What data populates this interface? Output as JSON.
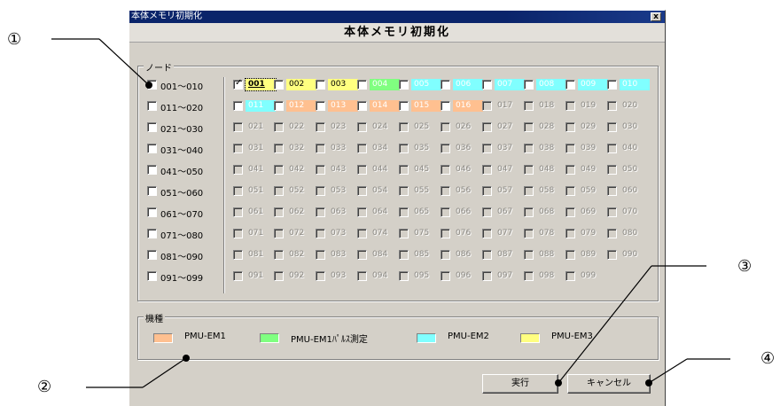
{
  "window": {
    "title": "本体メモリ初期化",
    "close": "x"
  },
  "header": {
    "title": "本体メモリ初期化"
  },
  "node_group": {
    "label": "ノード",
    "rows": [
      {
        "range": "001～010",
        "cells": [
          {
            "label": "001",
            "kind": "yellow",
            "checked": true
          },
          {
            "label": "002",
            "kind": "yellow"
          },
          {
            "label": "003",
            "kind": "yellow"
          },
          {
            "label": "004",
            "kind": "green"
          },
          {
            "label": "005",
            "kind": "cyan"
          },
          {
            "label": "006",
            "kind": "cyan"
          },
          {
            "label": "007",
            "kind": "cyan"
          },
          {
            "label": "008",
            "kind": "cyan"
          },
          {
            "label": "009",
            "kind": "cyan"
          },
          {
            "label": "010",
            "kind": "cyan"
          }
        ]
      },
      {
        "range": "011～020",
        "cells": [
          {
            "label": "011",
            "kind": "cyan"
          },
          {
            "label": "012",
            "kind": "orange"
          },
          {
            "label": "013",
            "kind": "orange"
          },
          {
            "label": "014",
            "kind": "orange"
          },
          {
            "label": "015",
            "kind": "orange"
          },
          {
            "label": "016",
            "kind": "orange"
          },
          {
            "label": "017",
            "kind": "disabled"
          },
          {
            "label": "018",
            "kind": "disabled"
          },
          {
            "label": "019",
            "kind": "disabled"
          },
          {
            "label": "020",
            "kind": "disabled"
          }
        ]
      },
      {
        "range": "021～030",
        "cells": [
          {
            "label": "021"
          },
          {
            "label": "022"
          },
          {
            "label": "023"
          },
          {
            "label": "024"
          },
          {
            "label": "025"
          },
          {
            "label": "026"
          },
          {
            "label": "027"
          },
          {
            "label": "028"
          },
          {
            "label": "029"
          },
          {
            "label": "030"
          }
        ]
      },
      {
        "range": "031～040",
        "cells": [
          {
            "label": "031"
          },
          {
            "label": "032"
          },
          {
            "label": "033"
          },
          {
            "label": "034"
          },
          {
            "label": "035"
          },
          {
            "label": "036"
          },
          {
            "label": "037"
          },
          {
            "label": "038"
          },
          {
            "label": "039"
          },
          {
            "label": "040"
          }
        ]
      },
      {
        "range": "041～050",
        "cells": [
          {
            "label": "041"
          },
          {
            "label": "042"
          },
          {
            "label": "043"
          },
          {
            "label": "044"
          },
          {
            "label": "045"
          },
          {
            "label": "046"
          },
          {
            "label": "047"
          },
          {
            "label": "048"
          },
          {
            "label": "049"
          },
          {
            "label": "050"
          }
        ]
      },
      {
        "range": "051～060",
        "cells": [
          {
            "label": "051"
          },
          {
            "label": "052"
          },
          {
            "label": "053"
          },
          {
            "label": "054"
          },
          {
            "label": "055"
          },
          {
            "label": "056"
          },
          {
            "label": "057"
          },
          {
            "label": "058"
          },
          {
            "label": "059"
          },
          {
            "label": "060"
          }
        ]
      },
      {
        "range": "061～070",
        "cells": [
          {
            "label": "061"
          },
          {
            "label": "062"
          },
          {
            "label": "063"
          },
          {
            "label": "064"
          },
          {
            "label": "065"
          },
          {
            "label": "066"
          },
          {
            "label": "067"
          },
          {
            "label": "068"
          },
          {
            "label": "069"
          },
          {
            "label": "070"
          }
        ]
      },
      {
        "range": "071～080",
        "cells": [
          {
            "label": "071"
          },
          {
            "label": "072"
          },
          {
            "label": "073"
          },
          {
            "label": "074"
          },
          {
            "label": "075"
          },
          {
            "label": "076"
          },
          {
            "label": "077"
          },
          {
            "label": "078"
          },
          {
            "label": "079"
          },
          {
            "label": "080"
          }
        ]
      },
      {
        "range": "081～090",
        "cells": [
          {
            "label": "081"
          },
          {
            "label": "082"
          },
          {
            "label": "083"
          },
          {
            "label": "084"
          },
          {
            "label": "085"
          },
          {
            "label": "086"
          },
          {
            "label": "087"
          },
          {
            "label": "088"
          },
          {
            "label": "089"
          },
          {
            "label": "090"
          }
        ]
      },
      {
        "range": "091～099",
        "cells": [
          {
            "label": "091"
          },
          {
            "label": "092"
          },
          {
            "label": "093"
          },
          {
            "label": "094"
          },
          {
            "label": "095"
          },
          {
            "label": "096"
          },
          {
            "label": "097"
          },
          {
            "label": "098"
          },
          {
            "label": "099"
          }
        ]
      }
    ]
  },
  "type_group": {
    "label": "機種",
    "items": [
      {
        "label": "PMU-EM1",
        "color": "#ffc090"
      },
      {
        "label": "PMU-EM1ﾊﾟﾙｽ測定",
        "color": "#80ff80"
      },
      {
        "label": "PMU-EM2",
        "color": "#80ffff"
      },
      {
        "label": "PMU-EM3",
        "color": "#ffff80"
      }
    ]
  },
  "buttons": {
    "execute": "実行",
    "cancel": "キャンセル"
  },
  "colors": {
    "yellow": "#ffff80",
    "green": "#80ff80",
    "cyan": "#80ffff",
    "orange": "#ffc090"
  },
  "callouts": [
    "①",
    "②",
    "③",
    "④"
  ]
}
